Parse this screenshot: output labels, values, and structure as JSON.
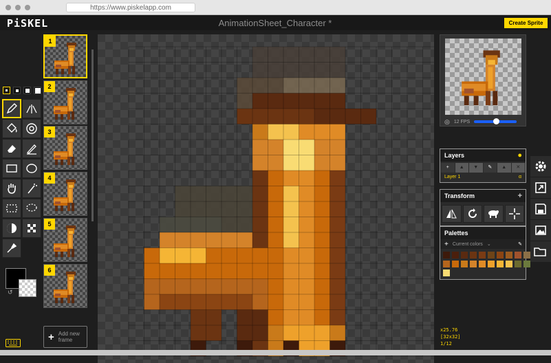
{
  "browser": {
    "url": "https://www.piskelapp.com"
  },
  "header": {
    "logo": "PiSKEL",
    "title": "AnimationSheet_Character *",
    "create_label": "Create Sprite"
  },
  "frames": [
    {
      "index": "1"
    },
    {
      "index": "2"
    },
    {
      "index": "3"
    },
    {
      "index": "4"
    },
    {
      "index": "5"
    },
    {
      "index": "6"
    }
  ],
  "add_frame_label": "Add new frame",
  "fps_label": "12 FPS",
  "fps_value": 12,
  "layers": {
    "title": "Layers",
    "name": "Layer 1",
    "opacity": "α"
  },
  "transform": {
    "title": "Transform"
  },
  "palettes": {
    "title": "Palettes",
    "current": "Current colors",
    "colors": [
      "#3d1a0b",
      "#4b1f0c",
      "#5a2a10",
      "#6b3412",
      "#7a3b14",
      "#6e4418",
      "#8b4513",
      "#9a5a1f",
      "#a0522d",
      "#8b6f47",
      "#b5651d",
      "#c8690a",
      "#c97a1a",
      "#d4832a",
      "#e08b26",
      "#eea12b",
      "#f5b535",
      "#f4c24e",
      "#6b6a2f",
      "#6b7a3d",
      "#f9dc73"
    ]
  },
  "zoom": {
    "scale": "x25.76",
    "size": "[32x32]",
    "frame": "1/12"
  }
}
